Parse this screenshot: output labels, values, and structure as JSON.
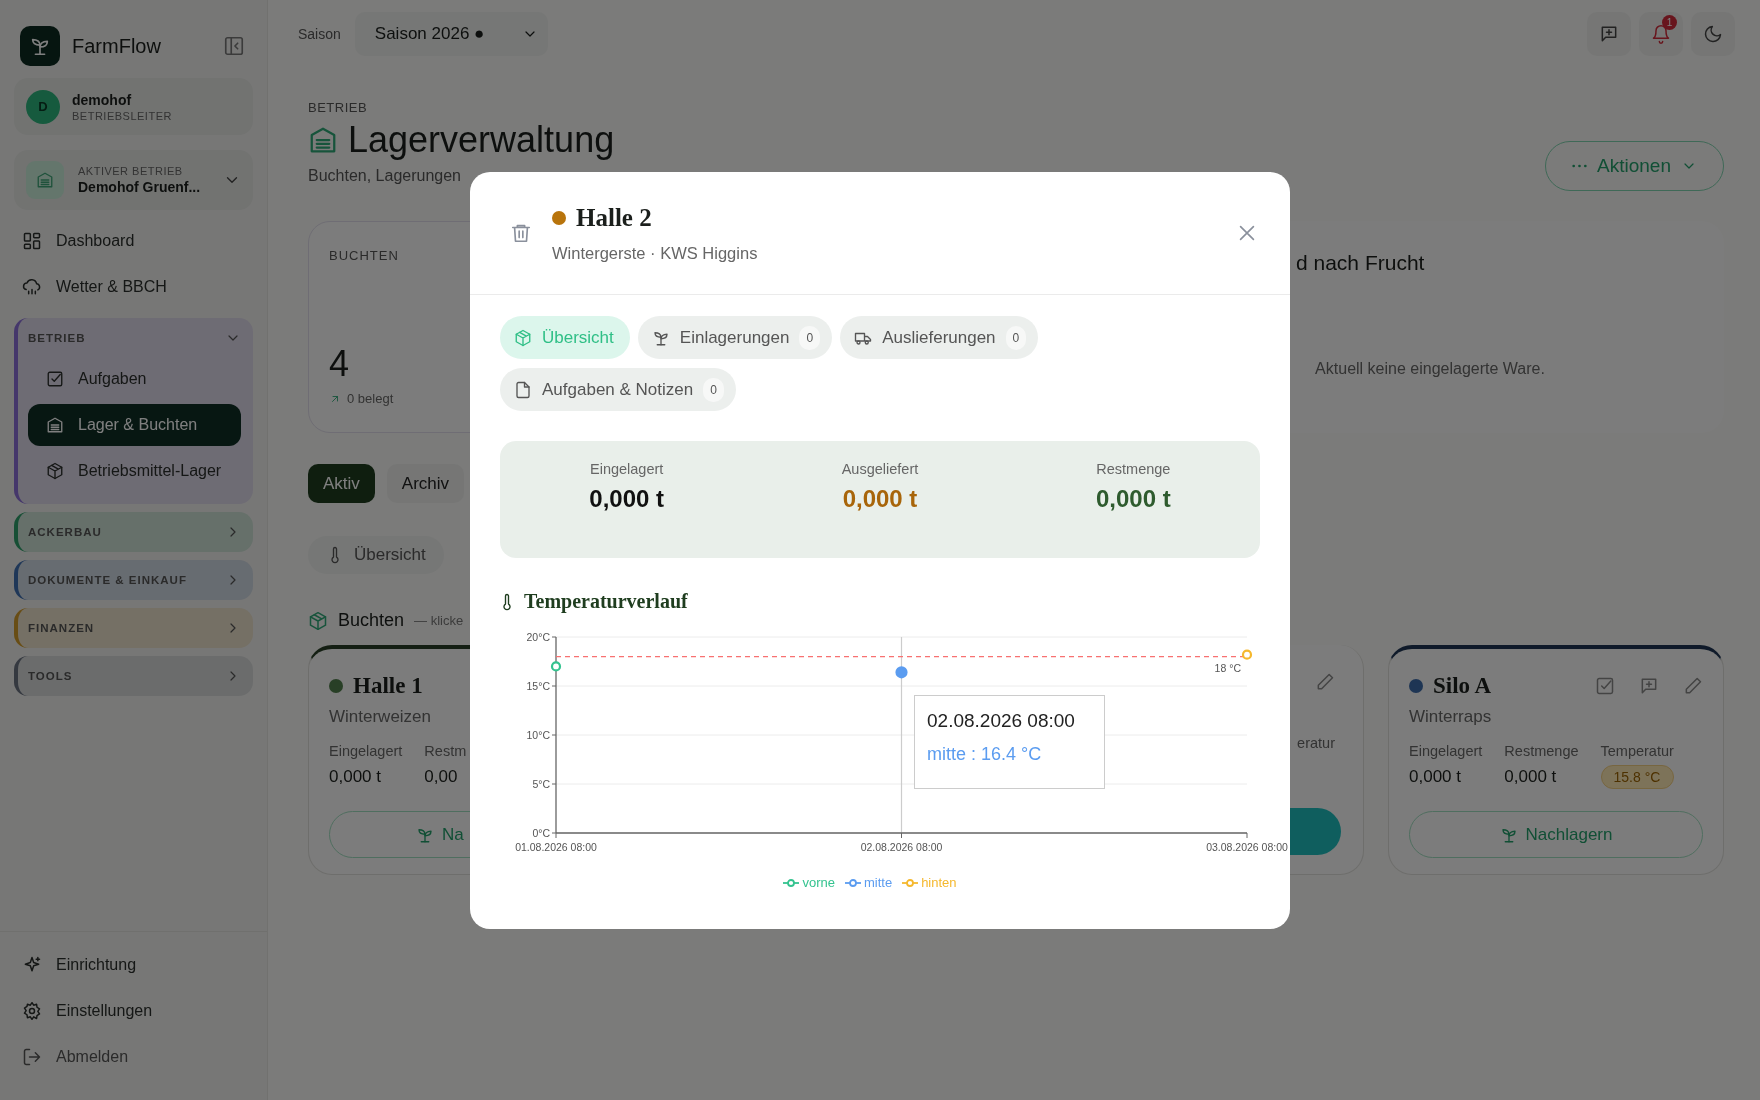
{
  "sidebar": {
    "brand": "FarmFlow",
    "user": {
      "initial": "D",
      "name": "demohof",
      "role": "BETRIEBSLEITER"
    },
    "business": {
      "label": "AKTIVER BETRIEB",
      "name": "Demohof Gruenf..."
    },
    "nav": [
      {
        "label": "Dashboard"
      },
      {
        "label": "Wetter & BBCH"
      }
    ],
    "groups": [
      {
        "label": "BETRIEB",
        "expanded": true,
        "children": [
          {
            "label": "Aufgaben",
            "selected": false
          },
          {
            "label": "Lager & Buchten",
            "selected": true
          },
          {
            "label": "Betriebsmittel-Lager",
            "selected": false
          }
        ]
      },
      {
        "label": "ACKERBAU",
        "expanded": false
      },
      {
        "label": "DOKUMENTE & EINKAUF",
        "expanded": false
      },
      {
        "label": "FINANZEN",
        "expanded": false
      },
      {
        "label": "TOOLS",
        "expanded": false
      }
    ],
    "footer": [
      {
        "label": "Einrichtung"
      },
      {
        "label": "Einstellungen"
      },
      {
        "label": "Abmelden"
      }
    ]
  },
  "topbar": {
    "season_label": "Saison",
    "season": "Saison 2026 ●",
    "notifications": "1"
  },
  "page": {
    "section": "BETRIEB",
    "title": "Lagerverwaltung",
    "subtitle": "Buchten, Lagerungen",
    "actions": "Aktionen"
  },
  "stat": {
    "label": "BUCHTEN",
    "value": "4",
    "note": "0 belegt"
  },
  "crop_panel": {
    "title": "d nach Frucht",
    "empty": "Aktuell keine eingelagerte Ware."
  },
  "tabs": [
    {
      "label": "Aktiv",
      "selected": true
    },
    {
      "label": "Archiv",
      "selected": false
    }
  ],
  "filters": [
    {
      "label": "Übersicht",
      "selected": false
    }
  ],
  "bays_heading": {
    "title": "Buchten",
    "hint": "— klicke"
  },
  "bay_left": {
    "name": "Halle 1",
    "color": "#283f26",
    "crop": "Winterweizen",
    "stats": [
      {
        "label": "Eingelagert",
        "value": "0,000 t"
      },
      {
        "label": "Restm",
        "value": "0,00"
      }
    ],
    "button": "Na"
  },
  "bay_partial": {
    "label": "eratur"
  },
  "bay_right": {
    "name": "Silo A",
    "color": "#1e3554",
    "crop": "Winterraps",
    "stats": [
      {
        "label": "Eingelagert",
        "value": "0,000 t",
        "kind": "text"
      },
      {
        "label": "Restmenge",
        "value": "0,000 t",
        "kind": "text"
      },
      {
        "label": "Temperatur",
        "value": "15.8 °C",
        "kind": "badge"
      }
    ],
    "button": "Nachlagern"
  },
  "dialog": {
    "color": "#b8740c",
    "title": "Halle 2",
    "subtitle": "Wintergerste · KWS Higgins",
    "tabs": [
      {
        "label": "Übersicht",
        "selected": true
      },
      {
        "label": "Einlagerungen",
        "count": "0",
        "selected": false
      },
      {
        "label": "Auslieferungen",
        "count": "0",
        "selected": false
      },
      {
        "label": "Aufgaben & Notizen",
        "count": "0",
        "selected": false
      }
    ],
    "summary": [
      {
        "label": "Eingelagert",
        "value": "0,000 t",
        "color": "#111111"
      },
      {
        "label": "Ausgeliefert",
        "value": "0,000 t",
        "color": "#a8650a"
      },
      {
        "label": "Restmenge",
        "value": "0,000 t",
        "color": "#2e5b2e"
      }
    ],
    "chart_title": "Temperaturverlauf",
    "chart_data": {
      "type": "line",
      "categories": [
        "01.08.2026 08:00",
        "02.08.2026 08:00",
        "03.08.2026 08:00"
      ],
      "series": [
        {
          "name": "vorne",
          "color": "#34c38f",
          "values": [
            17.0,
            null,
            null
          ],
          "marker": "open-circle"
        },
        {
          "name": "mitte",
          "color": "#5b9cf0",
          "values": [
            null,
            16.4,
            null
          ],
          "marker": "circle"
        },
        {
          "name": "hinten",
          "color": "#f5b82e",
          "values": [
            null,
            null,
            18.2
          ],
          "marker": "open-circle"
        }
      ],
      "ylim": [
        0,
        20
      ],
      "yticks": [
        {
          "value": 0,
          "label": "0°C"
        },
        {
          "value": 5,
          "label": "5°C"
        },
        {
          "value": 10,
          "label": "10°C"
        },
        {
          "value": 15,
          "label": "15°C"
        },
        {
          "value": 20,
          "label": "20°C"
        }
      ],
      "ref_lines": [
        {
          "axis": "y",
          "value": 18,
          "label": "18 °C",
          "color": "#f87171"
        },
        {
          "axis": "x",
          "value": "02.08.2026 08:00",
          "color": "#cccccc"
        }
      ],
      "grid": true,
      "legend": "bottom"
    },
    "tooltip": {
      "title": "02.08.2026 08:00",
      "text": "mitte : 16.4 °C"
    }
  }
}
